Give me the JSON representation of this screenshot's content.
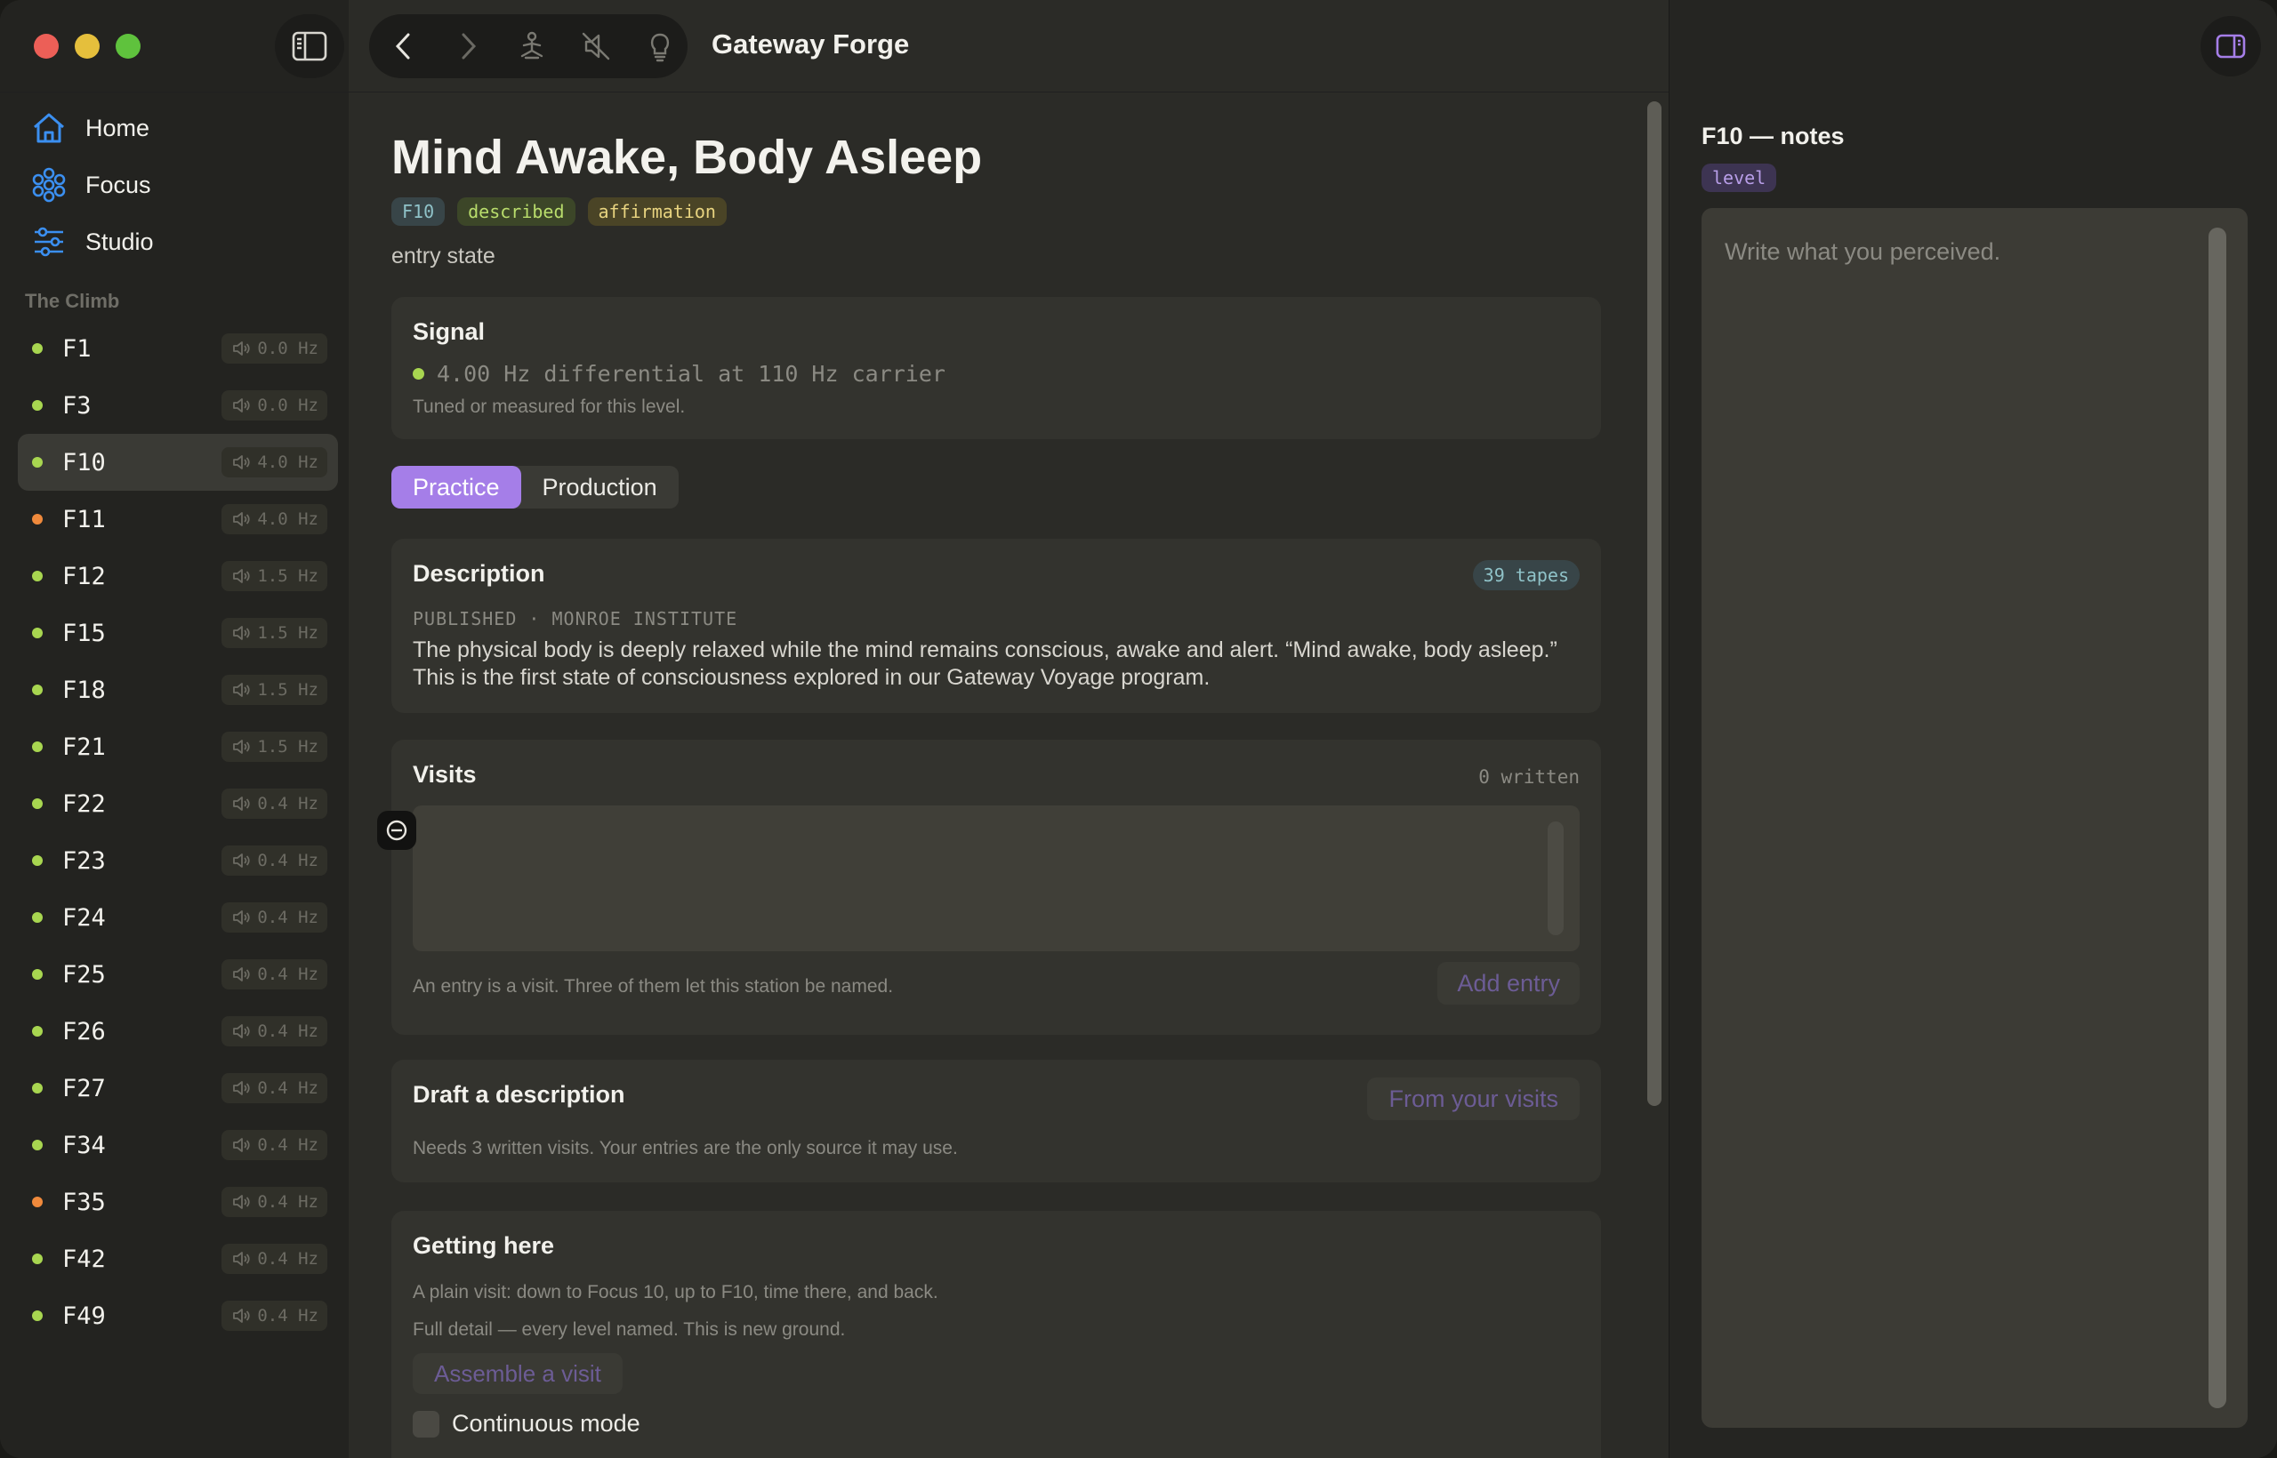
{
  "app": {
    "title": "Gateway Forge"
  },
  "nav": [
    {
      "label": "Home",
      "icon": "home-icon"
    },
    {
      "label": "Focus",
      "icon": "focus-icon"
    },
    {
      "label": "Studio",
      "icon": "sliders-icon"
    }
  ],
  "sidebar": {
    "section_label": "The Climb",
    "levels": [
      {
        "name": "F1",
        "hz": "0.0 Hz",
        "status": "green"
      },
      {
        "name": "F3",
        "hz": "0.0 Hz",
        "status": "green"
      },
      {
        "name": "F10",
        "hz": "4.0 Hz",
        "status": "green",
        "selected": true
      },
      {
        "name": "F11",
        "hz": "4.0 Hz",
        "status": "orange"
      },
      {
        "name": "F12",
        "hz": "1.5 Hz",
        "status": "green"
      },
      {
        "name": "F15",
        "hz": "1.5 Hz",
        "status": "green"
      },
      {
        "name": "F18",
        "hz": "1.5 Hz",
        "status": "green"
      },
      {
        "name": "F21",
        "hz": "1.5 Hz",
        "status": "green"
      },
      {
        "name": "F22",
        "hz": "0.4 Hz",
        "status": "green"
      },
      {
        "name": "F23",
        "hz": "0.4 Hz",
        "status": "green"
      },
      {
        "name": "F24",
        "hz": "0.4 Hz",
        "status": "green"
      },
      {
        "name": "F25",
        "hz": "0.4 Hz",
        "status": "green"
      },
      {
        "name": "F26",
        "hz": "0.4 Hz",
        "status": "green"
      },
      {
        "name": "F27",
        "hz": "0.4 Hz",
        "status": "green"
      },
      {
        "name": "F34",
        "hz": "0.4 Hz",
        "status": "green"
      },
      {
        "name": "F35",
        "hz": "0.4 Hz",
        "status": "orange"
      },
      {
        "name": "F42",
        "hz": "0.4 Hz",
        "status": "green"
      },
      {
        "name": "F49",
        "hz": "0.4 Hz",
        "status": "green"
      }
    ]
  },
  "colors": {
    "green": "#a8d650",
    "orange": "#f08a3c",
    "accent": "#a57ee8"
  },
  "main": {
    "title": "Mind Awake, Body Asleep",
    "tags": [
      "F10",
      "described",
      "affirmation"
    ],
    "subtitle": "entry state",
    "signal": {
      "title": "Signal",
      "value": "4.00 Hz differential at 110 Hz carrier",
      "note": "Tuned or measured for this level."
    },
    "tabs": [
      "Practice",
      "Production"
    ],
    "description": {
      "title": "Description",
      "badge": "39 tapes",
      "published": "PUBLISHED · MONROE INSTITUTE",
      "text": "The physical body is deeply relaxed while the mind remains conscious, awake and alert. “Mind awake, body asleep.” This is the first state of consciousness explored in our Gateway Voyage program."
    },
    "visits": {
      "title": "Visits",
      "count": "0 written",
      "note": "An entry is a visit. Three of them let this station be named.",
      "add_button": "Add entry"
    },
    "draft": {
      "title": "Draft a description",
      "button": "From your visits",
      "note": "Needs 3 written visits. Your entries are the only source it may use."
    },
    "getting_here": {
      "title": "Getting here",
      "line1": "A plain visit: down to Focus 10, up to F10, time there, and back.",
      "line2": "Full detail — every level named. This is new ground.",
      "button": "Assemble a visit",
      "continuous": "Continuous mode"
    }
  },
  "notes": {
    "title": "F10 — notes",
    "tag": "level",
    "placeholder": "Write what you perceived."
  }
}
